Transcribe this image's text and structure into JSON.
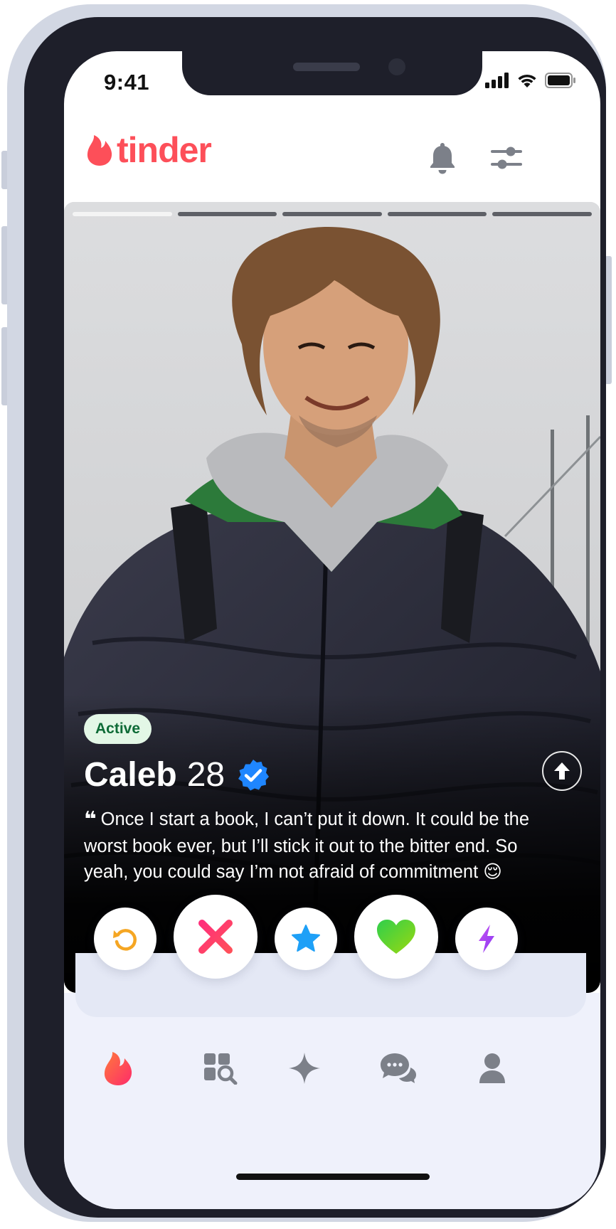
{
  "status_bar": {
    "time": "9:41"
  },
  "header": {
    "logo_text": "tinder"
  },
  "profile": {
    "status_badge": "Active",
    "name": "Caleb",
    "age": "28",
    "bio": "Once I start a book, I can’t put it down. It could be the worst book ever, but I’ll stick it out to the bitter end. So yeah, you could say I’m not afraid of commitment 😌",
    "photo_count": 5,
    "current_photo": 1
  },
  "actions": [
    {
      "name": "rewind",
      "icon": "rewind-icon",
      "color": "#f5a623"
    },
    {
      "name": "nope",
      "icon": "x-icon",
      "color": "#ff3c71"
    },
    {
      "name": "super-like",
      "icon": "star-icon",
      "color": "#1ea0f7"
    },
    {
      "name": "like",
      "icon": "heart-icon",
      "color": "#3fcf4c"
    },
    {
      "name": "boost",
      "icon": "lightning-icon",
      "color": "#a64bf4"
    }
  ],
  "nav": [
    {
      "name": "home",
      "icon": "flame-icon",
      "active": true
    },
    {
      "name": "explore",
      "icon": "explore-icon",
      "active": false
    },
    {
      "name": "gold",
      "icon": "sparkle-icon",
      "active": false
    },
    {
      "name": "messages",
      "icon": "chat-icon",
      "active": false
    },
    {
      "name": "profile",
      "icon": "person-icon",
      "active": false
    }
  ],
  "colors": {
    "brand": "#fd4f59",
    "active_badge_bg": "#e3f7e6",
    "active_badge_text": "#0d6b36"
  }
}
